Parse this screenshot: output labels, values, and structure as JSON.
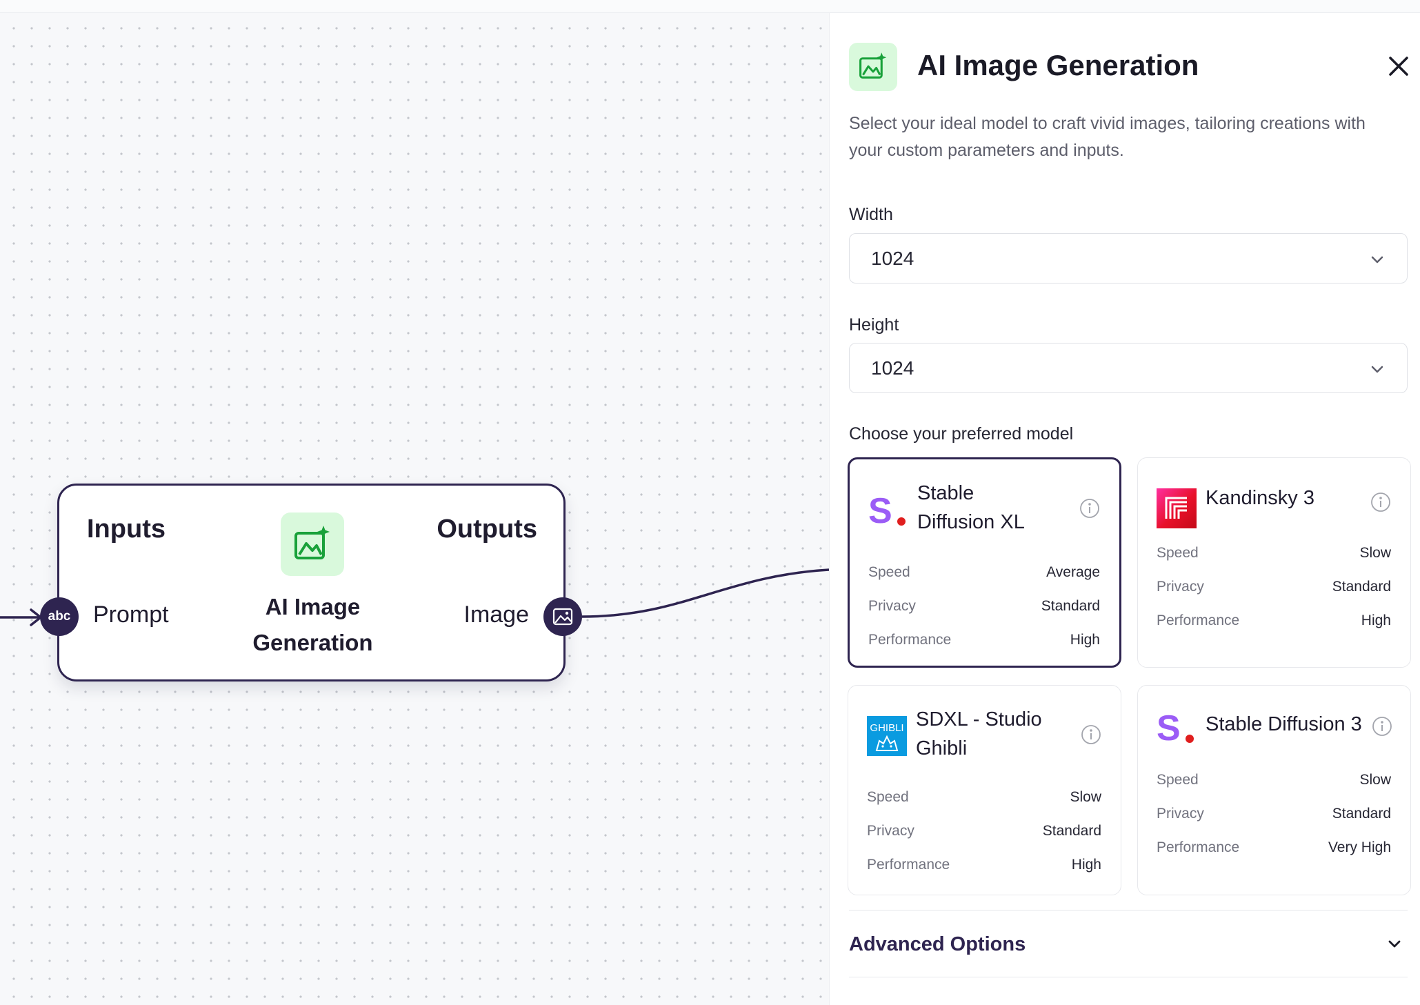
{
  "canvas": {
    "node": {
      "inputs_label": "Inputs",
      "outputs_label": "Outputs",
      "title_line1": "AI Image",
      "title_line2": "Generation",
      "input_port_label": "Prompt",
      "input_port_badge": "abc",
      "output_port_label": "Image"
    }
  },
  "panel": {
    "title": "AI Image Generation",
    "description": "Select your ideal model to craft vivid images, tailoring creations with your custom parameters and inputs.",
    "width": {
      "label": "Width",
      "value": "1024"
    },
    "height": {
      "label": "Height",
      "value": "1024"
    },
    "model_section_label": "Choose your preferred model",
    "models": [
      {
        "name": "Stable Diffusion XL",
        "logo": "stable-diffusion-logo",
        "selected": true,
        "rows": [
          {
            "label": "Speed",
            "value": "Average"
          },
          {
            "label": "Privacy",
            "value": "Standard"
          },
          {
            "label": "Performance",
            "value": "High"
          }
        ]
      },
      {
        "name": "Kandinsky 3",
        "logo": "kandinsky-logo",
        "selected": false,
        "rows": [
          {
            "label": "Speed",
            "value": "Slow"
          },
          {
            "label": "Privacy",
            "value": "Standard"
          },
          {
            "label": "Performance",
            "value": "High"
          }
        ]
      },
      {
        "name": "SDXL - Studio Ghibli",
        "logo": "ghibli-logo",
        "logo_text": "GHIBLI",
        "selected": false,
        "rows": [
          {
            "label": "Speed",
            "value": "Slow"
          },
          {
            "label": "Privacy",
            "value": "Standard"
          },
          {
            "label": "Performance",
            "value": "High"
          }
        ]
      },
      {
        "name": "Stable Diffusion 3",
        "logo": "stable-diffusion-logo",
        "selected": false,
        "rows": [
          {
            "label": "Speed",
            "value": "Slow"
          },
          {
            "label": "Privacy",
            "value": "Standard"
          },
          {
            "label": "Performance",
            "value": "Very High"
          }
        ]
      }
    ],
    "advanced_options_label": "Advanced Options"
  },
  "colors": {
    "accent": "#2e2450",
    "icon_green": "#19a13a",
    "icon_bg": "#d9f9dc",
    "sd_purple": "#9b5cf6",
    "sd_red": "#e01e1e"
  }
}
